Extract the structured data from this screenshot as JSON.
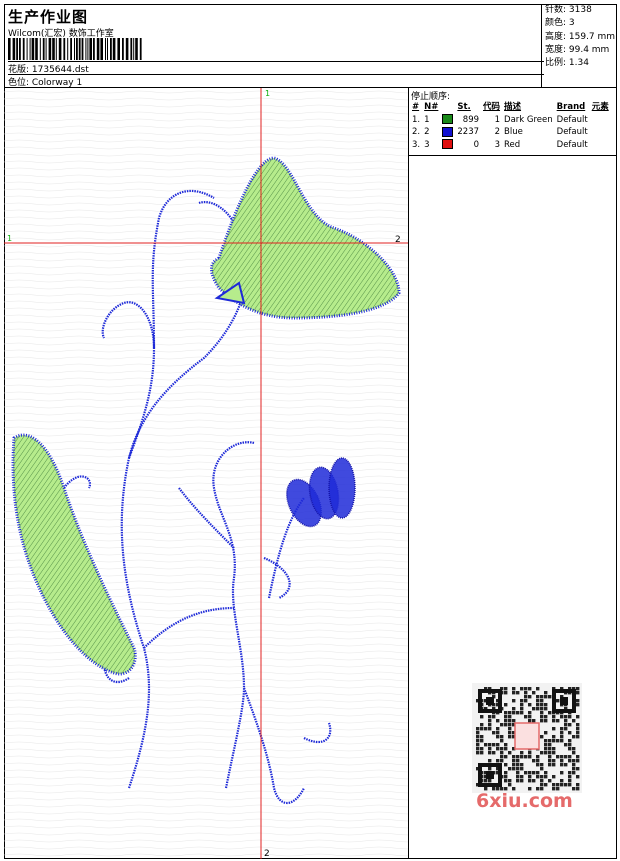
{
  "header": {
    "title": "生产作业图",
    "company": "Wilcom(汇宏) 数饰工作室",
    "design_label": "花版: 1735644.dst",
    "colorway_label": "色位: Colorway 1"
  },
  "stats": {
    "stitches": "针数: 3138",
    "colors": "颜色: 3",
    "height": "高度: 159.7 mm",
    "width": "宽度: 99.4 mm",
    "ratio": "比例: 1.34"
  },
  "stop_sequence": {
    "title": "停止顺序:",
    "headers": [
      "#",
      "N#",
      "St.",
      "代码",
      "描述",
      "Brand",
      "元素"
    ],
    "rows": [
      {
        "idx": "1.",
        "n": "1",
        "color": "#1a8a1a",
        "st": "899",
        "code": "1",
        "desc": "Dark Green",
        "brand": "Default"
      },
      {
        "idx": "2.",
        "n": "2",
        "color": "#1010d0",
        "st": "2237",
        "code": "2",
        "desc": "Blue",
        "brand": "Default"
      },
      {
        "idx": "3.",
        "n": "3",
        "color": "#e01010",
        "st": "0",
        "code": "3",
        "desc": "Red",
        "brand": "Default"
      }
    ]
  },
  "markers": {
    "v_top": "1",
    "v_bottom": "2",
    "h_left": "1",
    "h_right": "2"
  },
  "watermark": {
    "text": "6xiu.com"
  },
  "colors": {
    "stitch_blue": "#1e2ad8",
    "fill_green": "#b6ec8c",
    "guide_red": "#e02020",
    "marker_green": "#10b010"
  }
}
